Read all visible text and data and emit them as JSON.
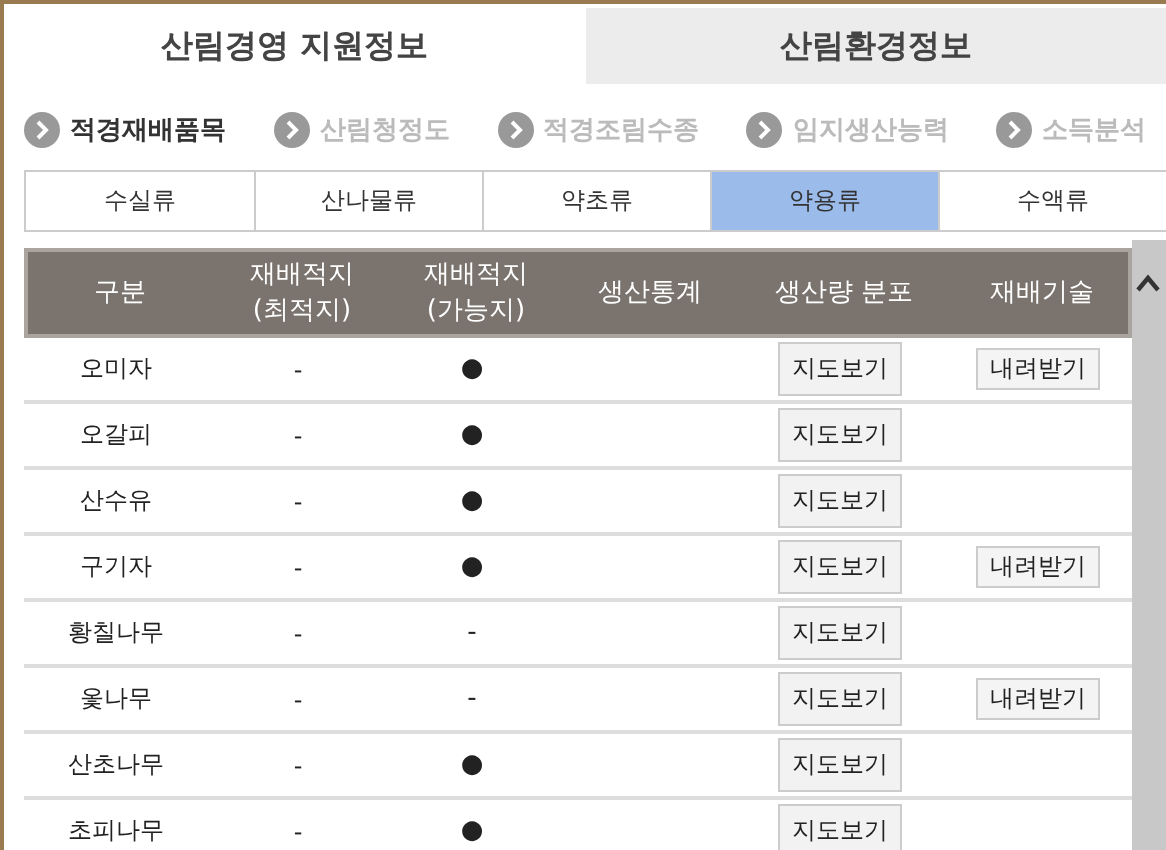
{
  "top_tabs": [
    {
      "label": "산림경영 지원정보",
      "selected": true
    },
    {
      "label": "산림환경정보",
      "selected": false
    }
  ],
  "steps": [
    {
      "label": "적경재배품목",
      "selected": true
    },
    {
      "label": "산림청정도",
      "selected": false
    },
    {
      "label": "적경조림수종",
      "selected": false
    },
    {
      "label": "임지생산능력",
      "selected": false
    },
    {
      "label": "소득분석",
      "selected": false
    }
  ],
  "categories": [
    {
      "label": "수실류",
      "selected": false
    },
    {
      "label": "산나물류",
      "selected": false
    },
    {
      "label": "약초류",
      "selected": false
    },
    {
      "label": "약용류",
      "selected": true
    },
    {
      "label": "수액류",
      "selected": false
    }
  ],
  "table": {
    "columns": [
      "구분",
      "재배적지\n(최적지)",
      "재배적지\n(가능지)",
      "생산통계",
      "생산량 분포",
      "재배기술"
    ],
    "rows": [
      {
        "name": "오미자",
        "optimal": "-",
        "possible": "●",
        "map_button": "지도보기",
        "download_button": "내려받기"
      },
      {
        "name": "오갈피",
        "optimal": "-",
        "possible": "●",
        "map_button": "지도보기"
      },
      {
        "name": "산수유",
        "optimal": "-",
        "possible": "●",
        "map_button": "지도보기"
      },
      {
        "name": "구기자",
        "optimal": "-",
        "possible": "●",
        "map_button": "지도보기",
        "download_button": "내려받기"
      },
      {
        "name": "황칠나무",
        "optimal": "-",
        "possible": "-",
        "map_button": "지도보기"
      },
      {
        "name": "옻나무",
        "optimal": "-",
        "possible": "-",
        "map_button": "지도보기",
        "download_button": "내려받기"
      },
      {
        "name": "산초나무",
        "optimal": "-",
        "possible": "●",
        "map_button": "지도보기"
      },
      {
        "name": "초피나무",
        "optimal": "-",
        "possible": "●",
        "map_button": "지도보기"
      }
    ]
  }
}
